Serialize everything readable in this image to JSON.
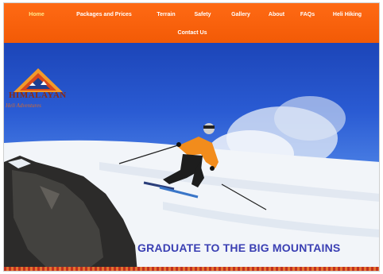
{
  "nav": {
    "items": [
      "Home",
      "Packages and Prices",
      "Terrain",
      "Safety",
      "Gallery",
      "About",
      "FAQs",
      "Heli Hiking"
    ],
    "second_row": "Contact Us",
    "active": "Home"
  },
  "logo": {
    "line1": "HIMALAYAN",
    "line2": "Heli Adventures"
  },
  "hero": {
    "tagline": "GRADUATE TO THE BIG MOUNTAINS"
  },
  "colors": {
    "nav_bg": "#f25a06",
    "sky": "#2a5bd3",
    "tagline": "#3a3fb3",
    "active_nav": "#ffe98a"
  }
}
